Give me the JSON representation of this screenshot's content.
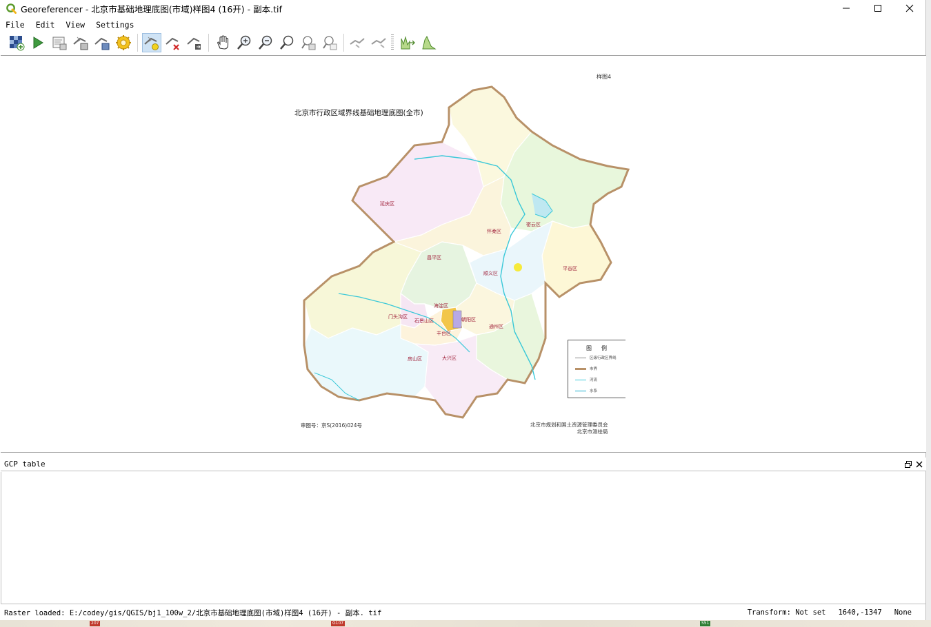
{
  "window": {
    "title": "Georeferencer - 北京市基础地理底图(市域)样图4 (16开)  - 副本.tif",
    "minimize_glyph": "—",
    "maximize_glyph": "☐",
    "close_glyph": "✕"
  },
  "menu": [
    "File",
    "Edit",
    "View",
    "Settings"
  ],
  "toolbar": {
    "buttons": [
      {
        "name": "open-raster-icon"
      },
      {
        "name": "start-georeferencing-icon"
      },
      {
        "name": "generate-gdal-script-icon"
      },
      {
        "name": "load-gcp-points-icon"
      },
      {
        "name": "save-gcp-points-icon"
      },
      {
        "name": "transformation-settings-icon"
      },
      {
        "name": "add-point-icon",
        "active": true
      },
      {
        "name": "delete-point-icon"
      },
      {
        "name": "move-gcp-point-icon"
      },
      {
        "name": "pan-icon"
      },
      {
        "name": "zoom-in-icon"
      },
      {
        "name": "zoom-out-icon"
      },
      {
        "name": "zoom-to-layer-icon"
      },
      {
        "name": "zoom-last-icon"
      },
      {
        "name": "zoom-next-icon"
      },
      {
        "name": "link-georeferencer-to-qgis-icon"
      },
      {
        "name": "link-qgis-to-georeferencer-icon"
      },
      {
        "name": "full-histogram-stretch-icon"
      },
      {
        "name": "local-histogram-stretch-icon"
      }
    ]
  },
  "map": {
    "title": "北京市行政区域界线基础地理底图(全市)",
    "corner_label": "样图4",
    "footer_left": "审图号：京S(2016)024号",
    "footer_right_line1": "北京市规划和国土资源管理委员会",
    "footer_right_line2": "北京市测绘局",
    "legend_title": "图例",
    "legend_items": [
      "区级行政区界线",
      "市界",
      "河流",
      "水系"
    ],
    "districts": [
      "延庆区",
      "怀柔区",
      "密云区",
      "昌平区",
      "平谷区",
      "顺义区",
      "门头沟区",
      "海淀区",
      "朝阳区",
      "石景山区",
      "通州区",
      "丰台区",
      "房山区",
      "大兴区"
    ],
    "colors": {
      "boundary": "#b89168",
      "river": "#39c8d8"
    }
  },
  "gcp_panel": {
    "title": "GCP table",
    "float_glyph": "🗗",
    "close_glyph": "✕"
  },
  "status": {
    "message": "Raster loaded: E:/codey/gis/QGIS/bj1_100w_2/北京市基础地理底图(市域)样图4 (16开)  - 副本. tif",
    "transform": "Transform: Not set",
    "coordinates": "1640,-1347",
    "crs": "None"
  },
  "background_roads": [
    "207",
    "G107",
    "S51"
  ]
}
